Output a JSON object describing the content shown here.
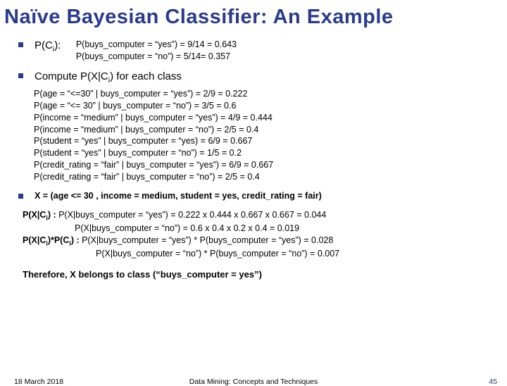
{
  "title": "Naïve Bayesian Classifier:  An Example",
  "pci": {
    "label": "P(Ci):",
    "line1": "P(buys_computer = “yes”)  = 9/14 = 0.643",
    "line2": "P(buys_computer = “no”) = 5/14= 0.357"
  },
  "compute_heading": "Compute P(X|Ci) for each class",
  "cond": {
    "l1": "P(age = “<=30” | buys_computer = “yes”)  = 2/9 = 0.222",
    "l2": "P(age = “<= 30” | buys_computer = “no”) = 3/5 = 0.6",
    "l3": "P(income = “medium” | buys_computer = “yes”) = 4/9 = 0.444",
    "l4": "P(income = “medium” | buys_computer = “no”) = 2/5 = 0.4",
    "l5": "P(student = “yes” | buys_computer = “yes) = 6/9 = 0.667",
    "l6": "P(student = “yes” | buys_computer = “no”) = 1/5 = 0.2",
    "l7": "P(credit_rating = “fair” | buys_computer = “yes”) = 6/9 = 0.667",
    "l8": "P(credit_rating = “fair” | buys_computer = “no”) = 2/5 = 0.4"
  },
  "xdef": "X = (age <= 30 , income = medium, student = yes, credit_rating = fair)",
  "pxci": {
    "label1a": "P(X|Ci) : ",
    "l1": "P(X|buys_computer = “yes”) = 0.222 x 0.444 x 0.667 x 0.667 = 0.044",
    "l2": "P(X|buys_computer = “no”) = 0.6 x 0.4 x 0.2 x 0.4 = 0.019",
    "label2a": "P(X|Ci)*P(Ci) : ",
    "l3": "P(X|buys_computer = “yes”) * P(buys_computer = “yes”) = 0.028",
    "l4": "P(X|buys_computer = “no”) * P(buys_computer = “no”) = 0.007"
  },
  "therefore": "Therefore,  X belongs to class (“buys_computer = yes”)",
  "footer": {
    "date": "18 March 2018",
    "mid": "Data Mining: Concepts and Techniques",
    "page": "45"
  }
}
